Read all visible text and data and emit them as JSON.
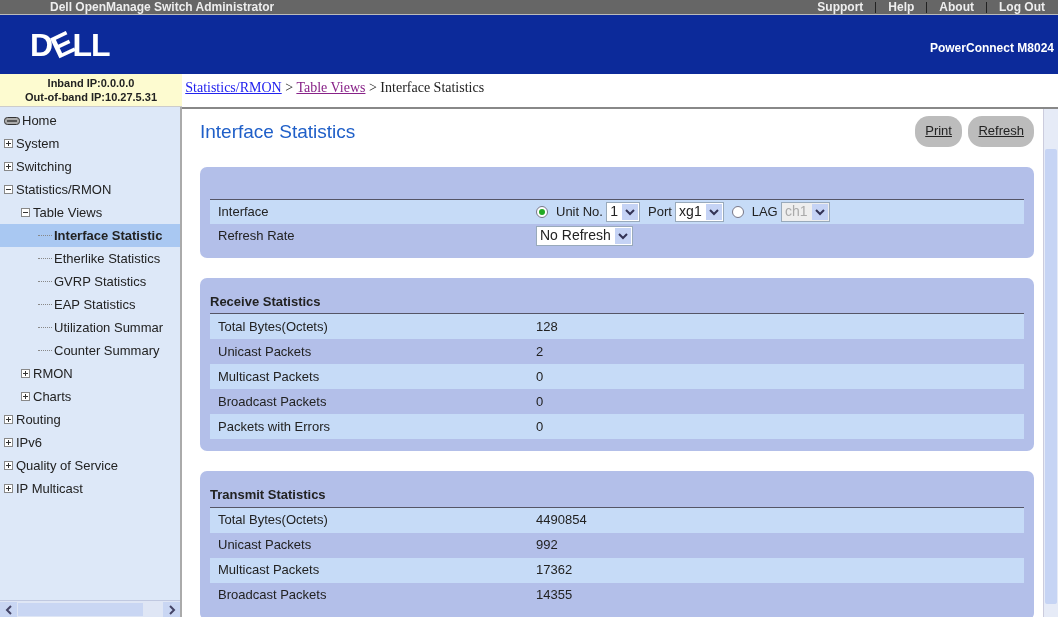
{
  "top_bar": {
    "title": "Dell OpenManage Switch Administrator",
    "links": [
      "Support",
      "Help",
      "About",
      "Log Out"
    ]
  },
  "header": {
    "logo": "DELL",
    "model": "PowerConnect M8024"
  },
  "ip_info": [
    "Inband IP:0.0.0.0",
    "Out-of-band IP:10.27.5.31"
  ],
  "breadcrumb": [
    {
      "label": "Statistics/RMON",
      "kind": "link"
    },
    {
      "label": ">",
      "kind": "separator"
    },
    {
      "label": "Table Views",
      "kind": "visited"
    },
    {
      "label": ">",
      "kind": "separator"
    },
    {
      "label": "Interface Statistics",
      "kind": "current"
    }
  ],
  "sidebar": {
    "items": [
      {
        "label": "Home",
        "kind": "root",
        "selected": false
      },
      {
        "label": "System",
        "kind": "folder",
        "expanded": false,
        "selected": false
      },
      {
        "label": "Switching",
        "kind": "folder",
        "expanded": false,
        "selected": false
      },
      {
        "label": "Statistics/RMON",
        "kind": "folder",
        "expanded": true,
        "selected": false,
        "children": [
          {
            "label": "Table Views",
            "kind": "folder",
            "expanded": true,
            "selected": false,
            "children": [
              {
                "label": "Interface Statistic",
                "kind": "page",
                "selected": true
              },
              {
                "label": "Etherlike Statistics",
                "kind": "page",
                "selected": false
              },
              {
                "label": "GVRP Statistics",
                "kind": "page",
                "selected": false
              },
              {
                "label": "EAP Statistics",
                "kind": "page",
                "selected": false
              },
              {
                "label": "Utilization Summar",
                "kind": "page",
                "selected": false
              },
              {
                "label": "Counter Summary",
                "kind": "page",
                "selected": false
              }
            ]
          },
          {
            "label": "RMON",
            "kind": "folder",
            "expanded": false,
            "selected": false
          },
          {
            "label": "Charts",
            "kind": "folder",
            "expanded": false,
            "selected": false
          }
        ]
      },
      {
        "label": "Routing",
        "kind": "folder",
        "expanded": false,
        "selected": false
      },
      {
        "label": "IPv6",
        "kind": "folder",
        "expanded": false,
        "selected": false
      },
      {
        "label": "Quality of Service",
        "kind": "folder",
        "expanded": false,
        "selected": false
      },
      {
        "label": "IP Multicast",
        "kind": "folder",
        "expanded": false,
        "selected": false
      }
    ]
  },
  "page": {
    "title": "Interface Statistics",
    "buttons": [
      "Print",
      "Refresh"
    ]
  },
  "filters": [
    {
      "label": "Interface",
      "controls": [
        {
          "kind": "radio",
          "label": "Unit No.",
          "selected": true
        },
        {
          "kind": "select",
          "value": "1",
          "disabled": false
        },
        {
          "kind": "label",
          "label": "Port"
        },
        {
          "kind": "select",
          "value": "xg1",
          "disabled": false
        },
        {
          "kind": "radio",
          "label": "LAG",
          "selected": false
        },
        {
          "kind": "select",
          "value": "ch1",
          "disabled": true
        }
      ]
    },
    {
      "label": "Refresh Rate",
      "controls": [
        {
          "kind": "select",
          "value": "No Refresh",
          "disabled": false
        }
      ]
    }
  ],
  "sections": [
    {
      "title": "Receive Statistics",
      "rows": [
        {
          "label": "Total Bytes(Octets)",
          "value": "128"
        },
        {
          "label": "Unicast Packets",
          "value": "2"
        },
        {
          "label": "Multicast Packets",
          "value": "0"
        },
        {
          "label": "Broadcast Packets",
          "value": "0"
        },
        {
          "label": "Packets with Errors",
          "value": "0"
        }
      ]
    },
    {
      "title": "Transmit Statistics",
      "rows": [
        {
          "label": "Total Bytes(Octets)",
          "value": "4490854"
        },
        {
          "label": "Unicast Packets",
          "value": "992"
        },
        {
          "label": "Multicast Packets",
          "value": "17362"
        },
        {
          "label": "Broadcast Packets",
          "value": "14355"
        }
      ]
    }
  ]
}
